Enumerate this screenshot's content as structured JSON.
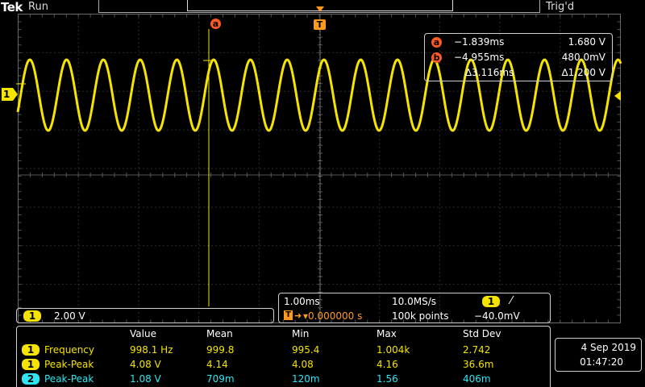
{
  "header": {
    "brand": "Tek",
    "run_state": "Run",
    "trigger_state": "Trig'd"
  },
  "markers": {
    "cursor_a": "a",
    "trigger_T": "T",
    "channel": "1"
  },
  "cursor_readout": {
    "a_label": "a",
    "a_time": "−1.839ms",
    "a_volt": "1.680 V",
    "b_label": "b",
    "b_time": "−4.955ms",
    "b_volt": "480.0mV",
    "delta_time": "∆3.116ms",
    "delta_volt": "∆1.200 V"
  },
  "channel_box": {
    "channel": "1",
    "scale": "2.00 V"
  },
  "horizontal_box": {
    "timebase": "1.00ms",
    "sample_rate": "10.0MS/s",
    "trig_channel": "1",
    "trig_slope": "⁄",
    "trig_position_prefix": "T",
    "trig_position": "▾0.000000 s",
    "record_length": "100k points",
    "trig_level": "−40.0mV"
  },
  "measurements": {
    "headers": [
      "Value",
      "Mean",
      "Min",
      "Max",
      "Std Dev"
    ],
    "rows": [
      {
        "ch": "1",
        "name": "Frequency",
        "values": [
          "998.1 Hz",
          "999.8",
          "995.4",
          "1.004k",
          "2.742"
        ]
      },
      {
        "ch": "1",
        "name": "Peak-Peak",
        "values": [
          "4.08 V",
          "4.14",
          "4.08",
          "4.16",
          "36.6m"
        ]
      },
      {
        "ch": "2",
        "name": "Peak-Peak",
        "values": [
          "1.08 V",
          "709m",
          "120m",
          "1.56",
          "406m"
        ]
      }
    ]
  },
  "datetime": {
    "date": "4 Sep 2019",
    "time": "01:47:20"
  },
  "colors": {
    "ch1": "#f5e300",
    "ch2": "#2ee6f2",
    "cursor": "#ff5a1f",
    "grid": "#6a6a6a"
  }
}
